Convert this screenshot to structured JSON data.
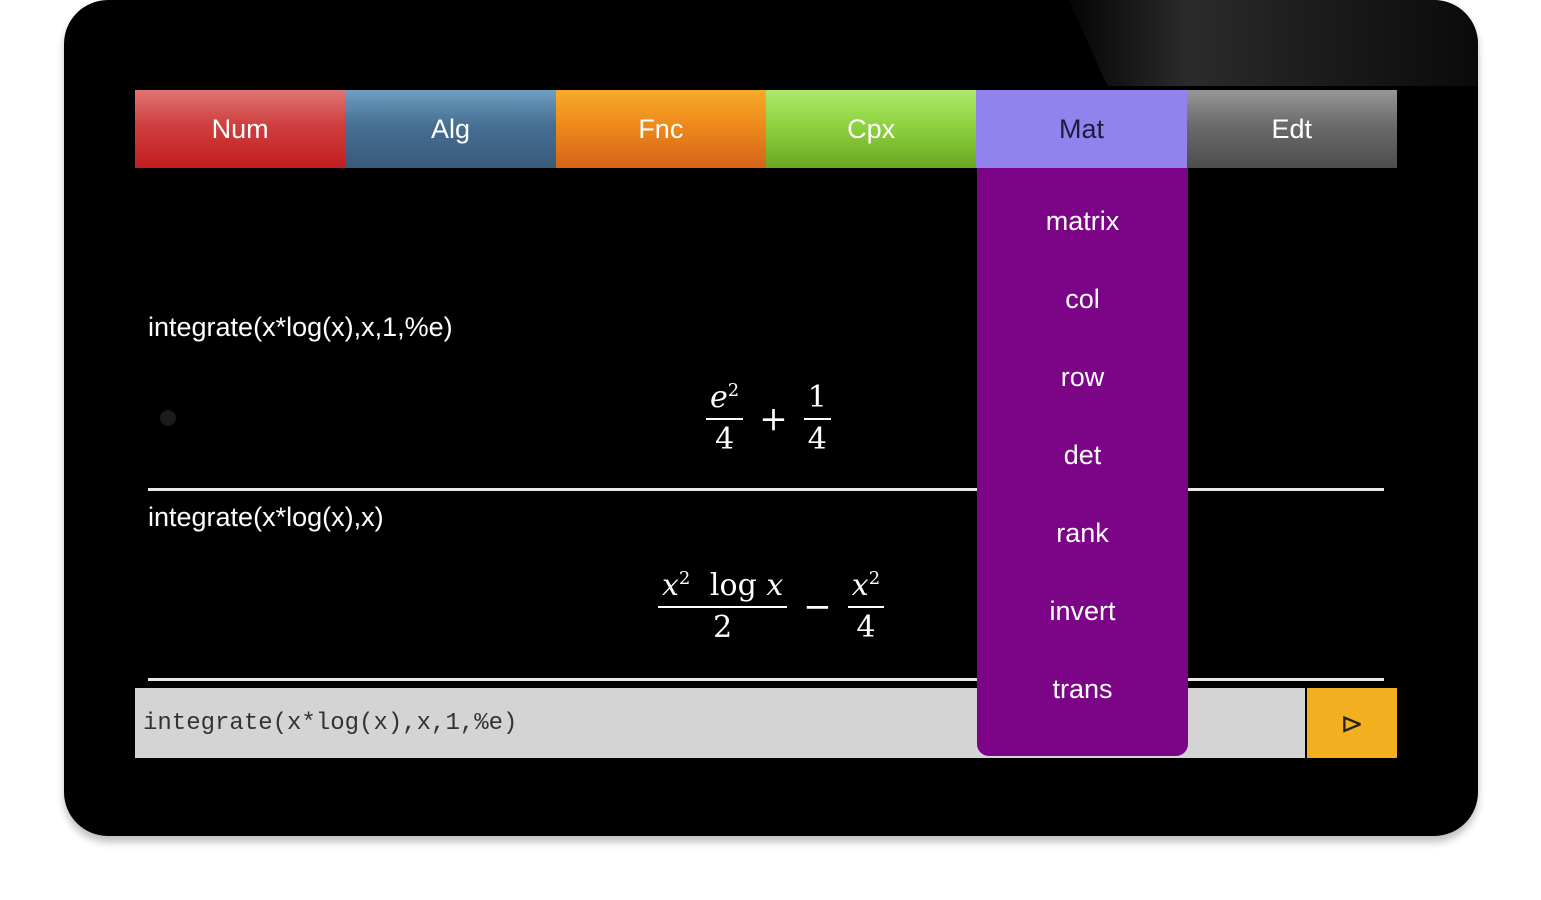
{
  "tabs": [
    {
      "label": "Num"
    },
    {
      "label": "Alg"
    },
    {
      "label": "Fnc"
    },
    {
      "label": "Cpx"
    },
    {
      "label": "Mat"
    },
    {
      "label": "Edt"
    }
  ],
  "active_tab": "Mat",
  "history": [
    {
      "input": "integrate(x*log(x),x,1,%e)",
      "result": {
        "left_num": "e",
        "left_exp": "2",
        "left_den": "4",
        "operator": "+",
        "right_num": "1",
        "right_den": "4"
      }
    },
    {
      "input": "integrate(x*log(x),x)",
      "result": {
        "left_num_base": "x",
        "left_exp": "2",
        "left_log": "log",
        "left_var": "x",
        "left_den": "2",
        "operator": "−",
        "right_num": "x",
        "right_exp": "2",
        "right_den": "4"
      }
    }
  ],
  "input_bar": {
    "value": "integrate(x*log(x),x,1,%e)"
  },
  "send_button": {
    "icon": "send-arrow-icon",
    "glyph": "⊳"
  },
  "mat_menu": {
    "items": [
      {
        "label": "matrix"
      },
      {
        "label": "col"
      },
      {
        "label": "row"
      },
      {
        "label": "det"
      },
      {
        "label": "rank"
      },
      {
        "label": "invert"
      },
      {
        "label": "trans"
      }
    ]
  },
  "colors": {
    "num": "#cf3f3f",
    "alg": "#466f93",
    "fnc": "#ee8a1c",
    "cpx": "#8fd33f",
    "mat": "#9183ee",
    "edt": "#6b6b6b",
    "dropdown": "#7c0587",
    "send": "#f2b020"
  }
}
